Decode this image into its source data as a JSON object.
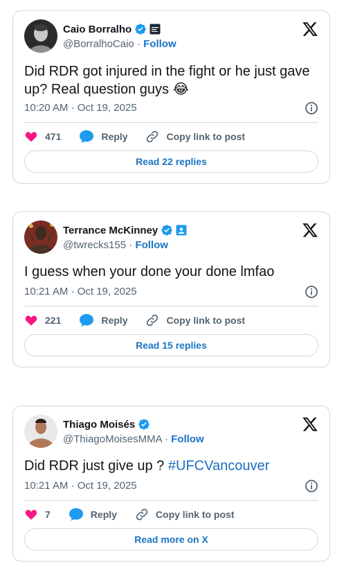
{
  "tweets": [
    {
      "name": "Caio Borralho",
      "handle": "@BorralhoCaio",
      "follow_label": "Follow",
      "separator": "·",
      "text": "Did RDR got injured in the fight or he just gave up? Real question guys",
      "emoji": "😂",
      "timestamp": "10:20 AM · Oct 19, 2025",
      "likes": "471",
      "reply_label": "Reply",
      "copy_label": "Copy link to post",
      "button_label": "Read 22 replies",
      "affiliate_icon": "affiliate-badge-icon"
    },
    {
      "name": "Terrance McKinney",
      "handle": "@twrecks155",
      "follow_label": "Follow",
      "separator": "·",
      "text": "I guess when your done your done lmfao",
      "timestamp": "10:21 AM · Oct 19, 2025",
      "likes": "221",
      "reply_label": "Reply",
      "copy_label": "Copy link to post",
      "button_label": "Read 15 replies",
      "affiliate_icon": "id-badge-icon"
    },
    {
      "name": "Thiago Moisés",
      "handle": "@ThiagoMoisesMMA",
      "follow_label": "Follow",
      "separator": "·",
      "text": "Did RDR just give up ?",
      "hashtag": "#UFCVancouver",
      "timestamp": "10:21 AM · Oct 19, 2025",
      "likes": "7",
      "reply_label": "Reply",
      "copy_label": "Copy link to post",
      "button_label": "Read more on X"
    }
  ],
  "colors": {
    "verified": "#1d9bf0",
    "like": "#f91880",
    "link": "#1b74c5",
    "border": "#cfd9de",
    "muted": "#536471"
  }
}
